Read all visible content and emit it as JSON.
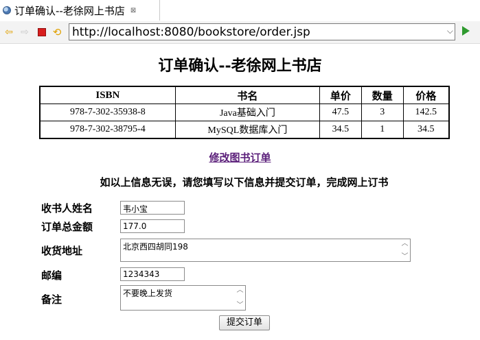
{
  "tab": {
    "title": "订单确认--老徐网上书店",
    "close_glyph": "⊠"
  },
  "toolbar": {
    "url": "http://localhost:8080/bookstore/order.jsp"
  },
  "page": {
    "heading": "订单确认--老徐网上书店",
    "table": {
      "headers": [
        "ISBN",
        "书名",
        "单价",
        "数量",
        "价格"
      ],
      "rows": [
        [
          "978-7-302-35938-8",
          "Java基础入门",
          "47.5",
          "3",
          "142.5"
        ],
        [
          "978-7-302-38795-4",
          "MySQL数据库入门",
          "34.5",
          "1",
          "34.5"
        ]
      ]
    },
    "edit_link": "修改图书订单",
    "notice": "如以上信息无误，请您填写以下信息并提交订单，完成网上订书",
    "form": {
      "name_label": "收书人姓名",
      "name_value": "韦小宝",
      "total_label": "订单总金额",
      "total_value": "177.0",
      "address_label": "收货地址",
      "address_value": "北京西四胡同198",
      "zip_label": "邮编",
      "zip_value": "1234343",
      "note_label": "备注",
      "note_value": "不要晚上发货",
      "submit_label": "提交订单"
    }
  }
}
